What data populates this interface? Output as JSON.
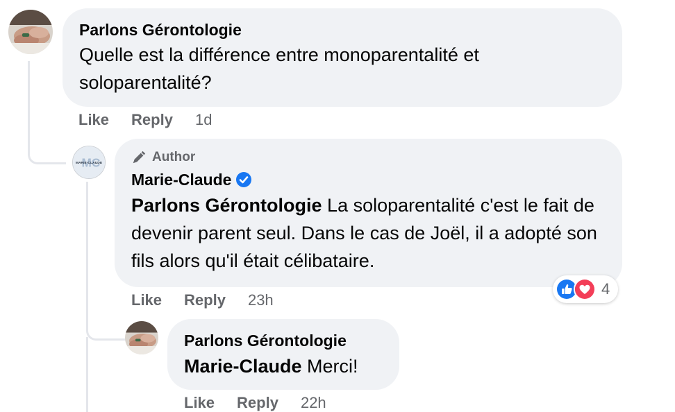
{
  "colors": {
    "bubble": "#f0f2f5",
    "secondary_text": "#65676b",
    "primary_text": "#050505",
    "like_blue": "#1877f2",
    "love_red": "#f33e58",
    "verified_blue": "#1877f2"
  },
  "comments": [
    {
      "author": "Parlons Gérontologie",
      "text": "Quelle est la différence entre monoparentalité et soloparentalité?",
      "actions": {
        "like": "Like",
        "reply": "Reply",
        "time": "1d"
      },
      "avatar_icon": "hands-photo-avatar"
    },
    {
      "badge": "Author",
      "badge_icon": "pen-icon",
      "author": "Marie-Claude",
      "verified_icon": "verified-badge-icon",
      "mention": "Parlons Gérontologie",
      "text": " La soloparentalité c'est le fait de devenir parent seul. Dans le cas de Joël, il a adopté son fils alors qu'il était célibataire.",
      "actions": {
        "like": "Like",
        "reply": "Reply",
        "time": "23h"
      },
      "avatar_icon": "mc-logo-avatar",
      "avatar_logo_text": "MARIE-CLAUDE",
      "reactions": {
        "icons": [
          "like-reaction-icon",
          "love-reaction-icon"
        ],
        "count": "4"
      }
    },
    {
      "author": "Parlons Gérontologie",
      "mention": "Marie-Claude",
      "text": " Merci!",
      "actions": {
        "like": "Like",
        "reply": "Reply",
        "time": "22h"
      },
      "avatar_icon": "hands-photo-avatar"
    }
  ]
}
